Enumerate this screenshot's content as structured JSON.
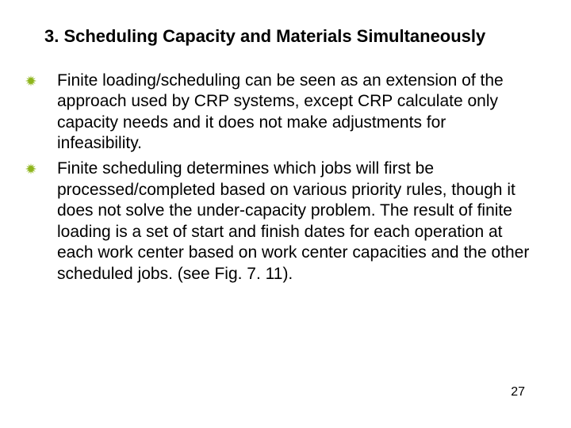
{
  "title": "3. Scheduling Capacity and Materials Simultaneously",
  "bullets": [
    "Finite loading/scheduling can be seen as an extension of the approach used by CRP systems, except CRP calculate only capacity needs and it does not make adjustments for infeasibility.",
    "Finite scheduling determines which jobs will first be processed/completed based on various priority rules, though it does not solve the under-capacity problem. The result of finite loading is a set of start and finish dates for each operation at each work center based on work center capacities and the other scheduled jobs. (see Fig. 7. 11)."
  ],
  "page_number": "27",
  "icon_color": "#8EB51C"
}
